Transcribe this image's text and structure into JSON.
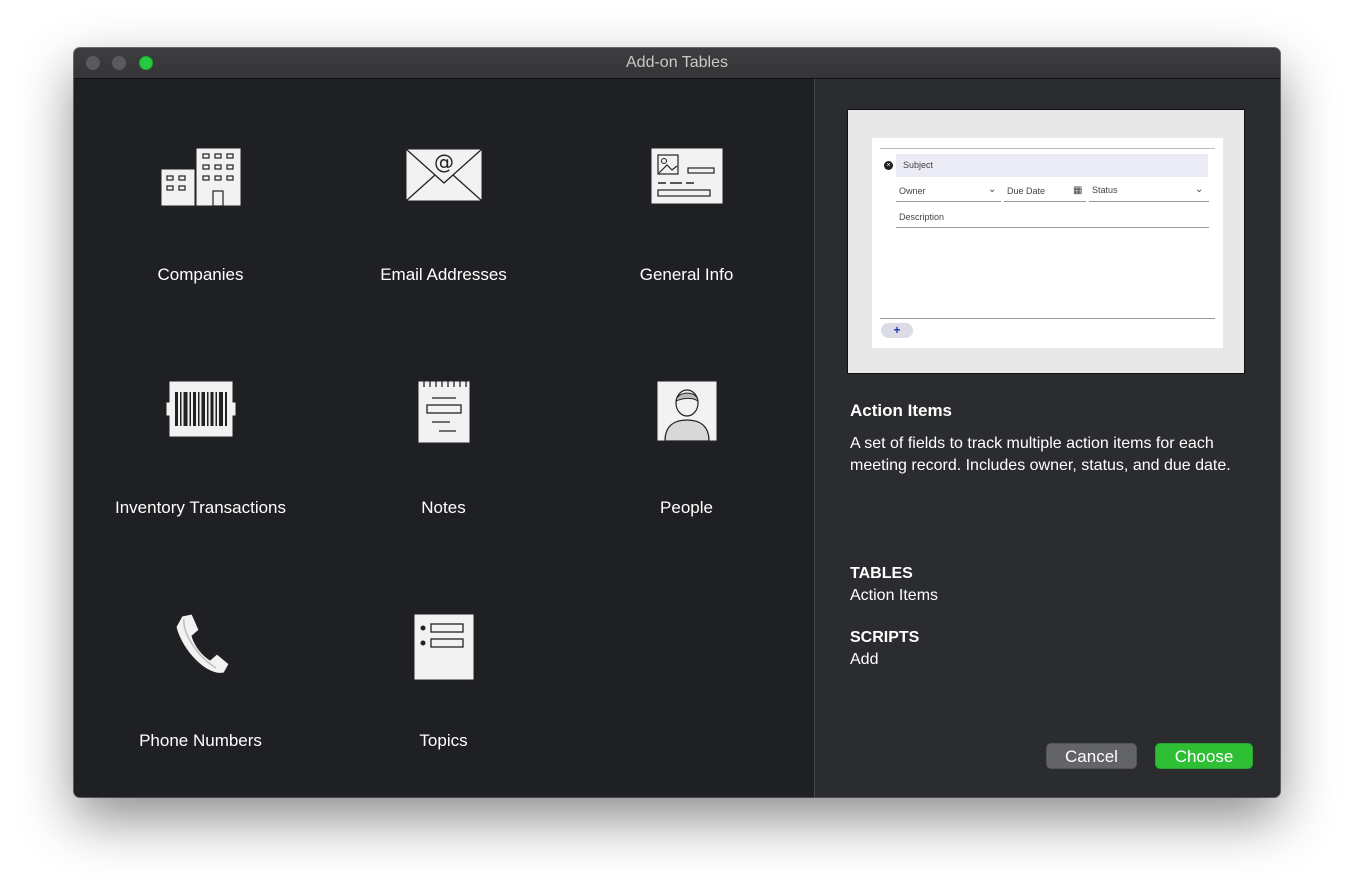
{
  "window": {
    "title": "Add-on Tables"
  },
  "tiles": [
    {
      "label": "Companies",
      "icon": "building-icon"
    },
    {
      "label": "Email Addresses",
      "icon": "envelope-icon"
    },
    {
      "label": "General Info",
      "icon": "id-card-icon"
    },
    {
      "label": "Inventory Transactions",
      "icon": "barcode-icon"
    },
    {
      "label": "Notes",
      "icon": "notepad-icon"
    },
    {
      "label": "People",
      "icon": "person-icon"
    },
    {
      "label": "Phone Numbers",
      "icon": "phone-icon"
    },
    {
      "label": "Topics",
      "icon": "list-icon"
    }
  ],
  "preview": {
    "subject": "Subject",
    "owner": "Owner",
    "due_date": "Due Date",
    "status": "Status",
    "description": "Description",
    "add": "+"
  },
  "detail": {
    "title": "Action Items",
    "description": "A set of fields to track multiple action items for each meeting record. Includes owner, status, and due date.",
    "tables_heading": "TABLES",
    "tables_value": "Action Items",
    "scripts_heading": "SCRIPTS",
    "scripts_value": "Add"
  },
  "buttons": {
    "cancel": "Cancel",
    "choose": "Choose"
  },
  "colors": {
    "accent": "#2fbf34",
    "window_bg": "#1f2023",
    "panel_bg": "#2b2c2f"
  }
}
